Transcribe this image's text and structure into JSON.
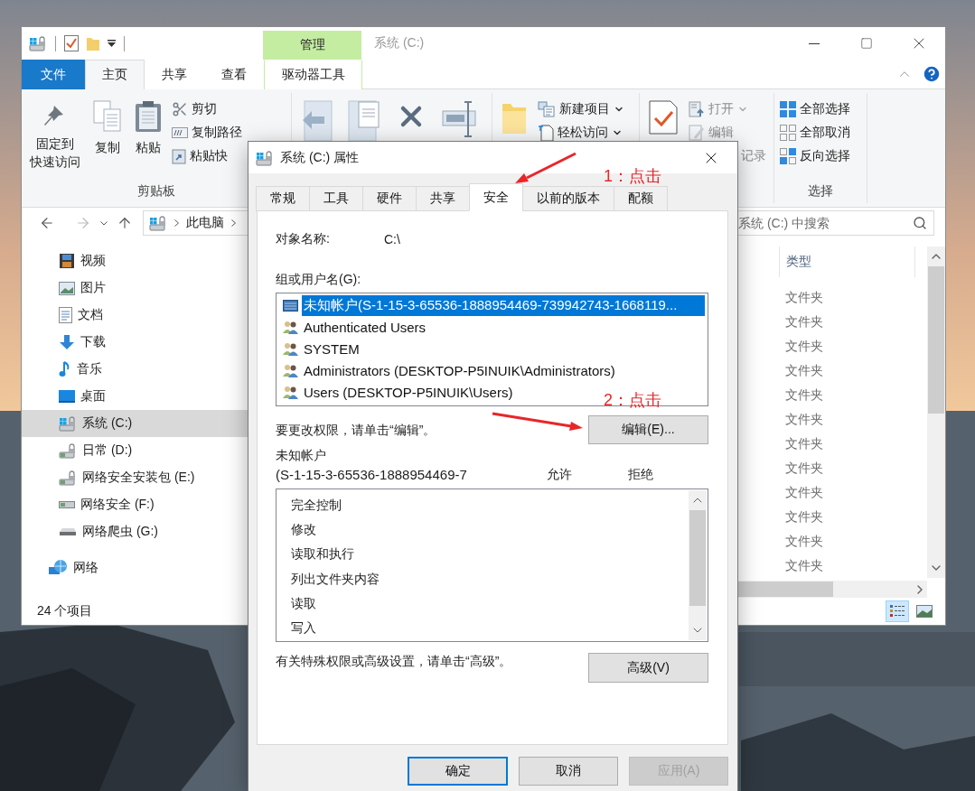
{
  "explorer": {
    "context_header": "管理",
    "title": "系统 (C:)",
    "tabs": [
      {
        "label": "文件",
        "kind": "file",
        "selected": false
      },
      {
        "label": "主页",
        "kind": "tab",
        "selected": true
      },
      {
        "label": "共享",
        "kind": "tab",
        "selected": false
      },
      {
        "label": "查看",
        "kind": "tab",
        "selected": false
      },
      {
        "label": "驱动器工具",
        "kind": "context",
        "selected": false
      }
    ],
    "ribbon": {
      "clipboard": {
        "large": [
          {
            "label": "固定到快速访问",
            "kind": "pin"
          },
          {
            "label": "复制",
            "kind": "copy"
          },
          {
            "label": "粘贴",
            "kind": "paste"
          }
        ],
        "small": [
          {
            "label": "剪切",
            "kind": "cut",
            "dropdown": false,
            "disabled": false
          },
          {
            "label": "复制路径",
            "kind": "copy-path",
            "dropdown": false,
            "disabled": false
          },
          {
            "label": "粘贴快",
            "kind": "paste-shortcut",
            "dropdown": false,
            "disabled": false
          }
        ],
        "group_label": "剪贴板"
      },
      "new": {
        "small": [
          {
            "label": "新建项目",
            "kind": "new-item",
            "dropdown": true,
            "disabled": false
          },
          {
            "label": "轻松访问",
            "kind": "easy-access",
            "dropdown": true,
            "disabled": false
          }
        ]
      },
      "open": {
        "small": [
          {
            "label": "打开",
            "kind": "open",
            "dropdown": true,
            "disabled": true
          },
          {
            "label": "编辑",
            "kind": "edit",
            "dropdown": false,
            "disabled": true
          },
          {
            "label": "记录",
            "kind": "history",
            "dropdown": false,
            "disabled": true
          }
        ]
      },
      "select": {
        "small": [
          {
            "label": "全部选择",
            "kind": "select-all",
            "dropdown": false,
            "disabled": false
          },
          {
            "label": "全部取消",
            "kind": "select-none",
            "dropdown": false,
            "disabled": false
          },
          {
            "label": "反向选择",
            "kind": "invert",
            "dropdown": false,
            "disabled": false
          }
        ],
        "group_label": "选择"
      }
    },
    "address": {
      "crumbs": [
        "此电脑"
      ]
    },
    "search": {
      "placeholder": "系统 (C:) 中搜索"
    },
    "nav": [
      {
        "label": "视频",
        "kind": "videos",
        "selected": false
      },
      {
        "label": "图片",
        "kind": "pictures",
        "selected": false
      },
      {
        "label": "文档",
        "kind": "documents",
        "selected": false
      },
      {
        "label": "下载",
        "kind": "downloads",
        "selected": false
      },
      {
        "label": "音乐",
        "kind": "music",
        "selected": false
      },
      {
        "label": "桌面",
        "kind": "desktop",
        "selected": false
      },
      {
        "label": "系统 (C:)",
        "kind": "system-drive",
        "selected": true
      },
      {
        "label": "日常 (D:)",
        "kind": "drive",
        "selected": false
      },
      {
        "label": "网络安全安装包 (E:)",
        "kind": "drive",
        "selected": false
      },
      {
        "label": "网络安全 (F:)",
        "kind": "removable",
        "selected": false
      },
      {
        "label": "网络爬虫 (G:)",
        "kind": "plain-drive",
        "selected": false
      },
      {
        "label": "网络",
        "kind": "network",
        "selected": false
      }
    ],
    "columns": [
      {
        "label": "类型"
      }
    ],
    "rows": [
      {
        "type": "文件夹"
      },
      {
        "type": "文件夹"
      },
      {
        "type": "文件夹"
      },
      {
        "type": "文件夹"
      },
      {
        "type": "文件夹"
      },
      {
        "type": "文件夹"
      },
      {
        "type": "文件夹"
      },
      {
        "type": "文件夹"
      },
      {
        "type": "文件夹"
      },
      {
        "type": "文件夹"
      },
      {
        "type": "文件夹"
      },
      {
        "type": "文件夹"
      }
    ],
    "status": "24 个项目",
    "views": [
      {
        "kind": "details",
        "selected": true
      },
      {
        "kind": "tiles",
        "selected": false
      }
    ]
  },
  "dialog": {
    "title": "系统 (C:) 属性",
    "tabs": [
      {
        "label": "常规",
        "selected": false
      },
      {
        "label": "工具",
        "selected": false
      },
      {
        "label": "硬件",
        "selected": false
      },
      {
        "label": "共享",
        "selected": false
      },
      {
        "label": "安全",
        "selected": true
      },
      {
        "label": "以前的版本",
        "selected": false
      },
      {
        "label": "配额",
        "selected": false
      }
    ],
    "object_label": "对象名称:",
    "object_value": "C:\\",
    "groups_label": "组或用户名(G):",
    "principals": [
      {
        "name": "未知帐户(S-1-15-3-65536-1888954469-739942743-1668119...",
        "kind": "unknown",
        "selected": true
      },
      {
        "name": "Authenticated Users",
        "kind": "group",
        "selected": false
      },
      {
        "name": "SYSTEM",
        "kind": "group",
        "selected": false
      },
      {
        "name": "Administrators (DESKTOP-P5INUIK\\Administrators)",
        "kind": "group",
        "selected": false
      },
      {
        "name": "Users (DESKTOP-P5INUIK\\Users)",
        "kind": "group",
        "selected": false
      }
    ],
    "edit_hint": "要更改权限，请单击“编辑”。",
    "edit_button": "编辑(E)...",
    "subject": [
      "未知帐户",
      "(S-1-15-3-65536-1888954469-7"
    ],
    "permission_columns": [
      "允许",
      "拒绝"
    ],
    "permissions": [
      "完全控制",
      "修改",
      "读取和执行",
      "列出文件夹内容",
      "读取",
      "写入"
    ],
    "advanced_hint": "有关特殊权限或高级设置，请单击“高级”。",
    "advanced_button": "高级(V)",
    "buttons": [
      {
        "label": "确定",
        "default": true,
        "disabled": false
      },
      {
        "label": "取消",
        "default": false,
        "disabled": false
      },
      {
        "label": "应用(A)",
        "default": false,
        "disabled": true
      }
    ]
  },
  "annotations": [
    {
      "label": "1：点击"
    },
    {
      "label": "2：点击"
    }
  ]
}
